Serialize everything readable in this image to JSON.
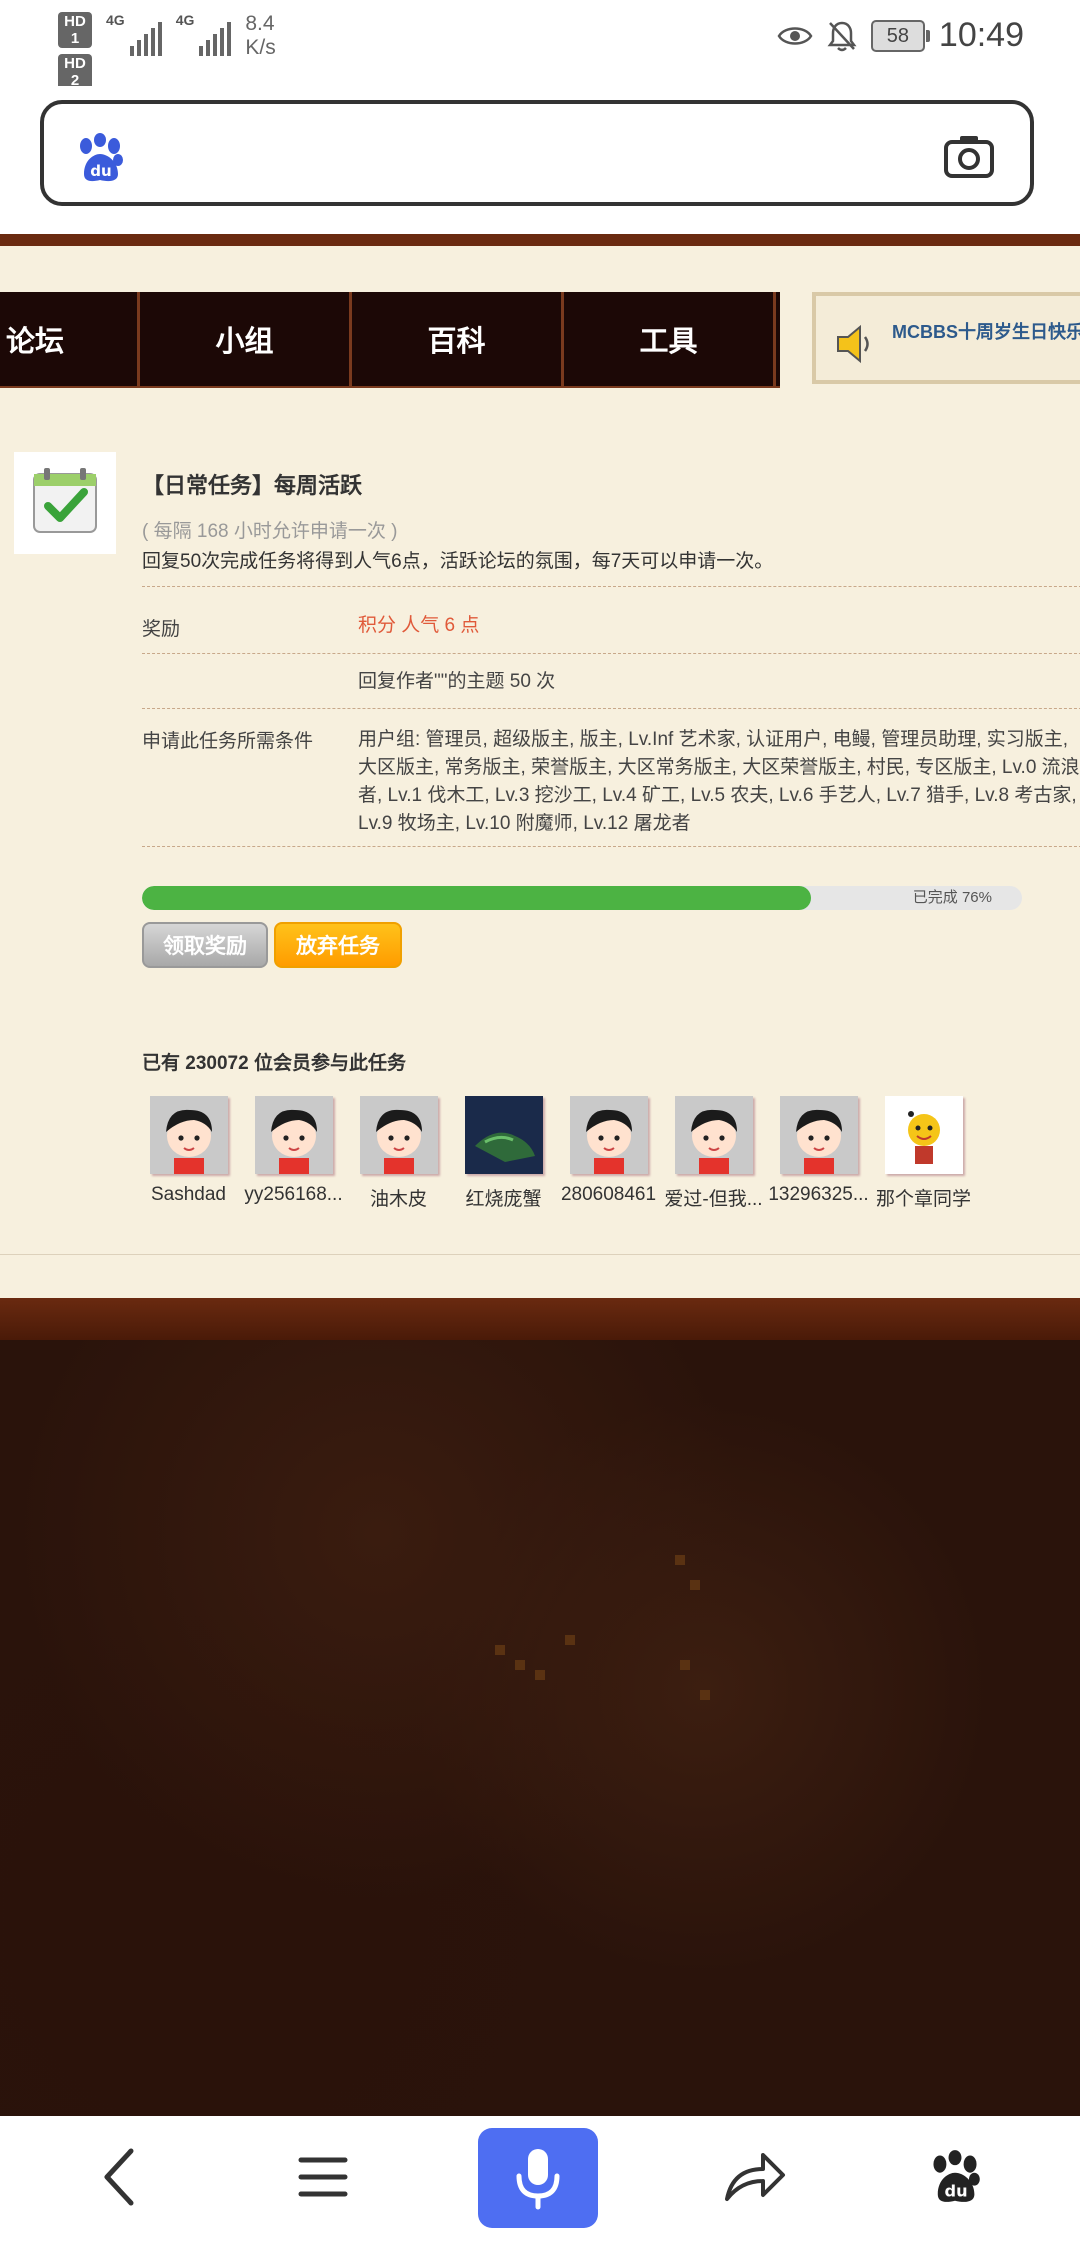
{
  "status_bar": {
    "sim1": "HD 1",
    "sim2": "HD 2",
    "net1": "4G",
    "net2": "4G",
    "speed_value": "8.4",
    "speed_unit": "K/s",
    "battery": "58",
    "time": "10:49"
  },
  "search": {
    "placeholder": ""
  },
  "nav": {
    "items": [
      "论坛",
      "小组",
      "百科",
      "工具"
    ],
    "notice": "MCBBS十周岁生日快乐"
  },
  "task": {
    "title": "【日常任务】每周活跃",
    "interval": "( 每隔 168 小时允许申请一次 )",
    "description": "回复50次完成任务将得到人气6点，活跃论坛的氛围，每7天可以申请一次。",
    "reward_label": "奖励",
    "reward_value": "积分 人气 6 点",
    "requirement": "回复作者\"\"的主题 50 次",
    "condition_label": "申请此任务所需条件",
    "condition_value": "用户组: 管理员, 超级版主, 版主, Lv.Inf 艺术家, 认证用户, 电鳗, 管理员助理, 实习版主, 大区版主, 常务版主, 荣誉版主, 大区常务版主, 大区荣誉版主, 村民, 专区版主, Lv.0 流浪者, Lv.1 伐木工, Lv.3 挖沙工, Lv.4 矿工, Lv.5 农夫, Lv.6 手艺人, Lv.7 猎手, Lv.8 考古家, Lv.9 牧场主, Lv.10 附魔师, Lv.12 屠龙者",
    "progress_percent": 76,
    "progress_text": "已完成 76%",
    "claim_button": "领取奖励",
    "quit_button": "放弃任务",
    "members_text": "已有 230072 位会员参与此任务"
  },
  "members": [
    {
      "name": "Sashdad",
      "avatar": "default"
    },
    {
      "name": "yy256168...",
      "avatar": "default"
    },
    {
      "name": "油木皮",
      "avatar": "default"
    },
    {
      "name": "红烧庞蟹",
      "avatar": "map"
    },
    {
      "name": "280608461",
      "avatar": "default"
    },
    {
      "name": "爱过-但我...",
      "avatar": "default"
    },
    {
      "name": "13296325...",
      "avatar": "default"
    },
    {
      "name": "那个章同学",
      "avatar": "cartoon"
    }
  ],
  "colors": {
    "accent": "#4e6ef2",
    "progress": "#4cb343",
    "quit_button": "#ff9c00",
    "reward_text": "#e05a3a",
    "nav_bg": "#1c0806",
    "page_bg": "#f7f0de"
  },
  "bottom_nav": {
    "icons": [
      "back-icon",
      "menu-icon",
      "mic-icon",
      "share-icon",
      "baidu-paw-icon"
    ]
  }
}
